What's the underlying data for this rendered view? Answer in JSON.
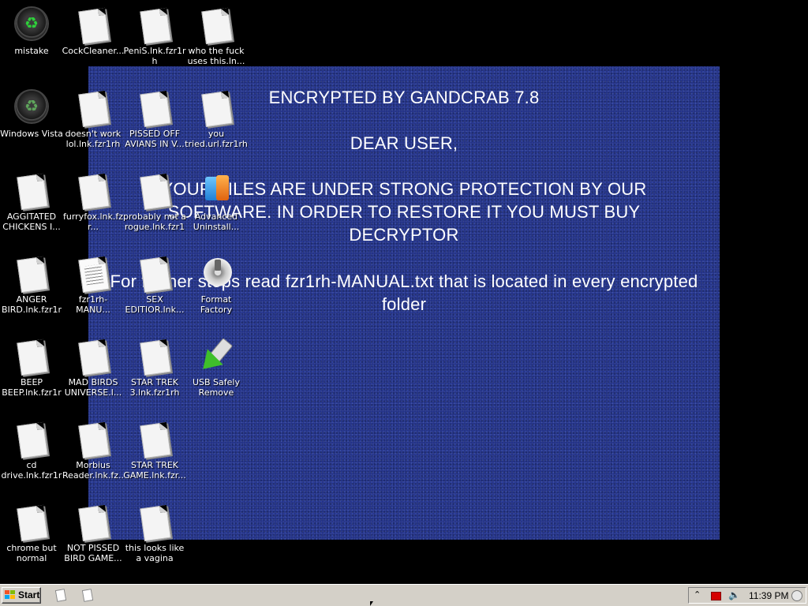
{
  "ransom": {
    "title": "ENCRYPTED BY GANDCRAB 7.8",
    "greeting": "DEAR USER,",
    "body": "YOUR FILES ARE UNDER STRONG PROTECTION BY OUR SOFTWARE. IN ORDER TO RESTORE IT YOU MUST BUY DECRYPTOR",
    "steps": "For further steps read fzr1rh-MANUAL.txt that is located in every encrypted folder",
    "background_color": "#1f2f86"
  },
  "icons": [
    {
      "label": "mistake",
      "type": "recycle-bin-empty"
    },
    {
      "label": "CockCleaner...",
      "type": "document"
    },
    {
      "label": "PeniS.lnk.fzr1rh",
      "type": "document"
    },
    {
      "label": "who the fuck uses this.ln...",
      "type": "document"
    },
    {
      "label": "Windows Vista",
      "type": "recycle-bin-full"
    },
    {
      "label": "doesn't work lol.lnk.fzr1rh",
      "type": "document"
    },
    {
      "label": "PISSED OFF AVIANS IN V...",
      "type": "document"
    },
    {
      "label": "you tried.url.fzr1rh",
      "type": "document"
    },
    {
      "label": "AGGITATED CHICKENS I...",
      "type": "document"
    },
    {
      "label": "furryfox.lnk.fzr...",
      "type": "document"
    },
    {
      "label": "probably not a rogue.lnk.fzr1rh",
      "type": "document"
    },
    {
      "label": "Advanced Uninstall...",
      "type": "uninstaller"
    },
    {
      "label": "ANGER BIRD.lnk.fzr1rh",
      "type": "document"
    },
    {
      "label": "fzr1rh-MANU...",
      "type": "text-document"
    },
    {
      "label": "SEX EDITIOR.lnk...",
      "type": "document"
    },
    {
      "label": "Format Factory",
      "type": "format-factory"
    },
    {
      "label": "BEEP BEEP.lnk.fzr1rh",
      "type": "document"
    },
    {
      "label": "MAD BIRDS UNIVERSE.l...",
      "type": "document"
    },
    {
      "label": "STAR TREK 3.lnk.fzr1rh",
      "type": "document"
    },
    {
      "label": "USB Safely Remove",
      "type": "usb"
    },
    {
      "label": "cd drive.lnk.fzr1rh",
      "type": "document"
    },
    {
      "label": "Morbius Reader.lnk.fz...",
      "type": "document"
    },
    {
      "label": "STAR TREK GAME.lnk.fzr...",
      "type": "document"
    },
    {
      "label": "chrome but normal colors....",
      "type": "document"
    },
    {
      "label": "NOT PISSED BIRD GAME...",
      "type": "document"
    },
    {
      "label": "this looks like a vagina lol.lnk...",
      "type": "document"
    }
  ],
  "taskbar": {
    "start_label": "Start",
    "quick_launch": [
      "document-icon",
      "document-icon"
    ],
    "clock": "11:39 PM",
    "tray_icons": [
      "chevron-up-icon",
      "red-flag-icon",
      "speaker-icon",
      "network-icon"
    ]
  }
}
